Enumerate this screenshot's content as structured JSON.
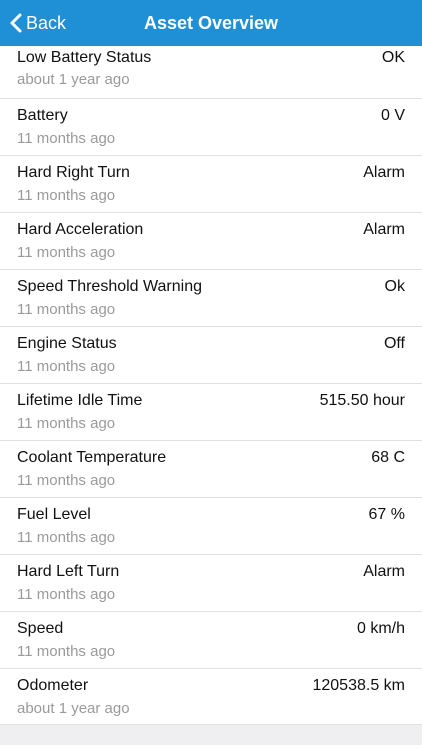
{
  "header": {
    "back_label": "Back",
    "title": "Asset Overview",
    "color": "#1f8fd6"
  },
  "items": [
    {
      "name": "Low Battery Status",
      "time": "about 1 year ago",
      "value": "OK"
    },
    {
      "name": "Battery",
      "time": "11 months ago",
      "value": "0 V"
    },
    {
      "name": "Hard Right Turn",
      "time": "11 months ago",
      "value": "Alarm"
    },
    {
      "name": "Hard Acceleration",
      "time": "11 months ago",
      "value": "Alarm"
    },
    {
      "name": "Speed Threshold Warning",
      "time": "11 months ago",
      "value": "Ok"
    },
    {
      "name": "Engine Status",
      "time": "11 months ago",
      "value": "Off"
    },
    {
      "name": "Lifetime Idle Time",
      "time": "11 months ago",
      "value": "515.50 hour"
    },
    {
      "name": "Coolant Temperature",
      "time": "11 months ago",
      "value": "68 C"
    },
    {
      "name": "Fuel Level",
      "time": "11 months ago",
      "value": "67 %"
    },
    {
      "name": "Hard Left Turn",
      "time": "11 months ago",
      "value": "Alarm"
    },
    {
      "name": "Speed",
      "time": "11 months ago",
      "value": "0 km/h"
    },
    {
      "name": "Odometer",
      "time": "about 1 year ago",
      "value": "120538.5 km"
    }
  ]
}
